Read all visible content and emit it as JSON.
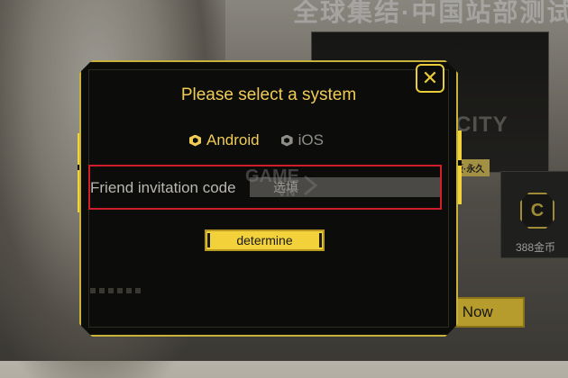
{
  "background": {
    "banner_title": "全球集结·中国站部测试",
    "panel_text": "CITY",
    "tag": "版·永久",
    "card_badge": "C",
    "card_label": "388金币",
    "small_label": "币",
    "reservation_label": "Reservation Now"
  },
  "modal": {
    "title": "Please select a system",
    "close_icon": "close-x-icon",
    "system_options": [
      {
        "label": "Android",
        "selected": true
      },
      {
        "label": "iOS",
        "selected": false
      }
    ],
    "invitation_placeholder": "Friend invitation code",
    "fill_hint": "选填",
    "determine_label": "determine"
  },
  "watermark_text": "GAME VN",
  "colors": {
    "accent": "#f0cc54",
    "button_yellow": "#f2d13b",
    "highlight_red": "#d01e2a",
    "modal_bg": "#0c0c0b"
  }
}
